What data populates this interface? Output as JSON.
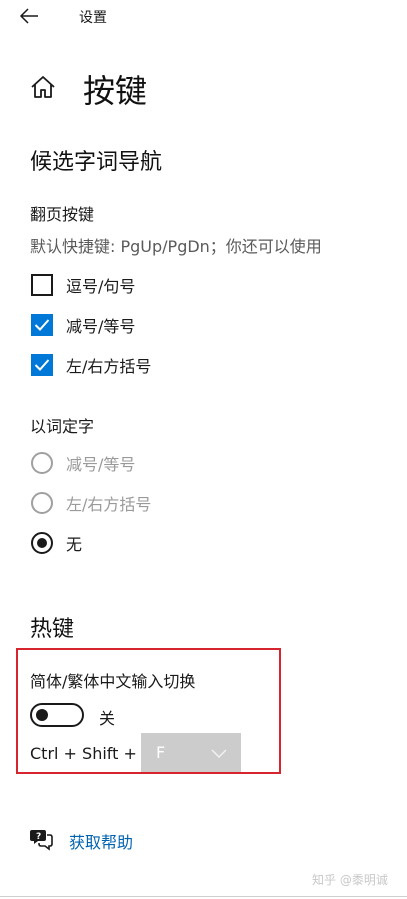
{
  "window": {
    "title": "设置"
  },
  "page": {
    "title": "按键"
  },
  "candidate_nav": {
    "title": "候选字词导航",
    "paging": {
      "label": "翻页按键",
      "description": "默认快捷键: PgUp/PgDn；你还可以使用",
      "options": [
        {
          "label": "逗号/句号",
          "checked": false
        },
        {
          "label": "减号/等号",
          "checked": true
        },
        {
          "label": "左/右方括号",
          "checked": true
        }
      ]
    },
    "word_select": {
      "label": "以词定字",
      "options": [
        {
          "label": "减号/等号",
          "selected": false,
          "disabled": true
        },
        {
          "label": "左/右方括号",
          "selected": false,
          "disabled": true
        },
        {
          "label": "无",
          "selected": true,
          "disabled": false
        }
      ]
    }
  },
  "hotkeys": {
    "title": "热键",
    "switch_setting": {
      "label": "简体/繁体中文输入切换",
      "toggle_state": "关",
      "is_on": false,
      "shortcut_prefix": "Ctrl + Shift +",
      "key_value": "F"
    }
  },
  "help": {
    "label": "获取帮助"
  },
  "watermark": "知乎 @黍明诚",
  "colors": {
    "accent": "#0078d7",
    "link": "#0063b1",
    "highlight_border": "#d6252e"
  }
}
